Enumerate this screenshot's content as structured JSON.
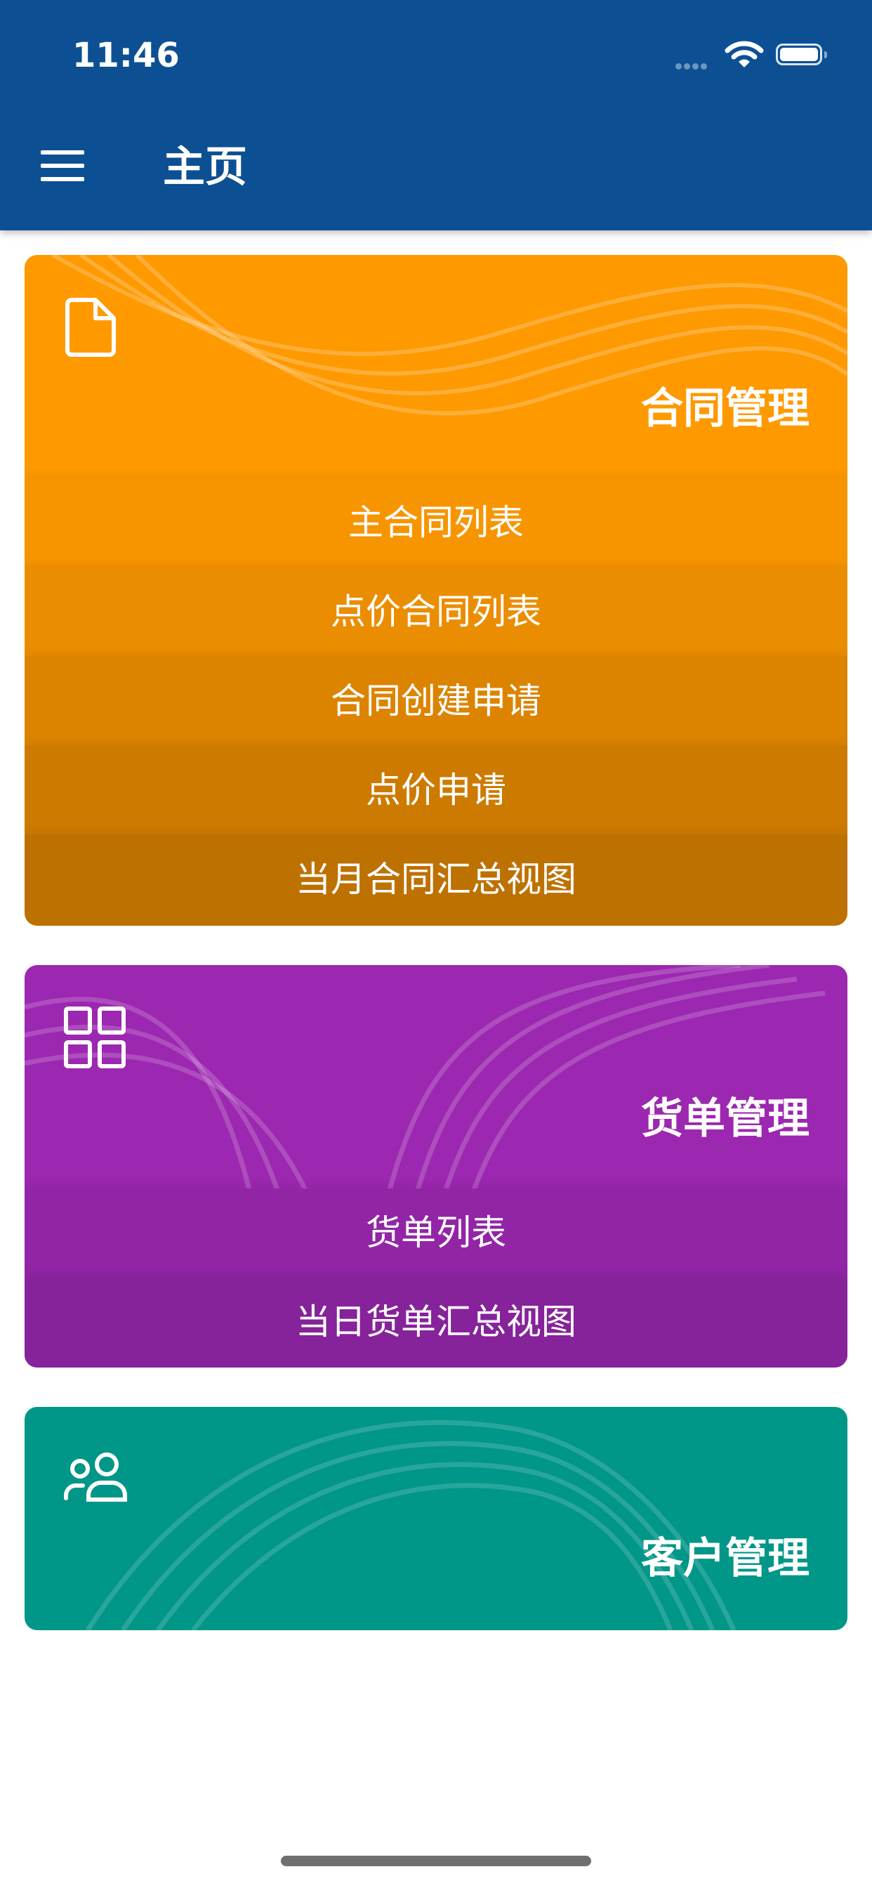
{
  "status_bar": {
    "time": "11:46"
  },
  "header": {
    "title": "主页"
  },
  "sections": {
    "contract": {
      "title": "合同管理",
      "color": "#ff9900",
      "items": [
        "主合同列表",
        "点价合同列表",
        "合同创建申请",
        "点价申请",
        "当月合同汇总视图"
      ]
    },
    "waybill": {
      "title": "货单管理",
      "color": "#9c27b0",
      "items": [
        "货单列表",
        "当日货单汇总视图"
      ]
    },
    "customer": {
      "title": "客户管理",
      "color": "#009688"
    }
  }
}
